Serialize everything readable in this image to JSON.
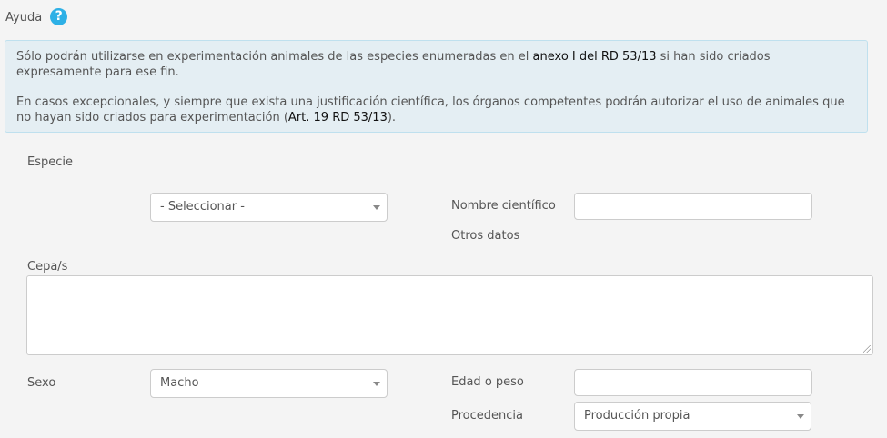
{
  "help": {
    "label": "Ayuda",
    "icon": "question-circle-icon"
  },
  "info": {
    "p1_before": "Sólo podrán utilizarse en experimentación animales de las especies enumeradas en el ",
    "p1_link": "anexo I del RD 53/13",
    "p1_after": " si han sido criados expresamente para ese fin.",
    "p2_before": "En casos excepcionales, y siempre que exista una justificación científica, los órganos competentes podrán autorizar el uso de animales que no hayan sido criados para experimentación (",
    "p2_link": "Art. 19 RD 53/13",
    "p2_after": ")."
  },
  "form": {
    "especie_label": "Especie",
    "especie_value": "- Seleccionar -",
    "nombre_cientifico_label": "Nombre científico",
    "nombre_cientifico_value": "",
    "otros_datos_label": "Otros datos",
    "cepa_label": "Cepa/s",
    "cepa_value": "",
    "sexo_label": "Sexo",
    "sexo_value": "Macho",
    "edad_label": "Edad o peso",
    "edad_value": "",
    "procedencia_label": "Procedencia",
    "procedencia_value": "Producción propia"
  },
  "colors": {
    "help_icon": "#2db0e6",
    "info_bg": "#e4eef3",
    "info_border": "#bfe0ee",
    "page_bg": "#f4f4f4"
  }
}
